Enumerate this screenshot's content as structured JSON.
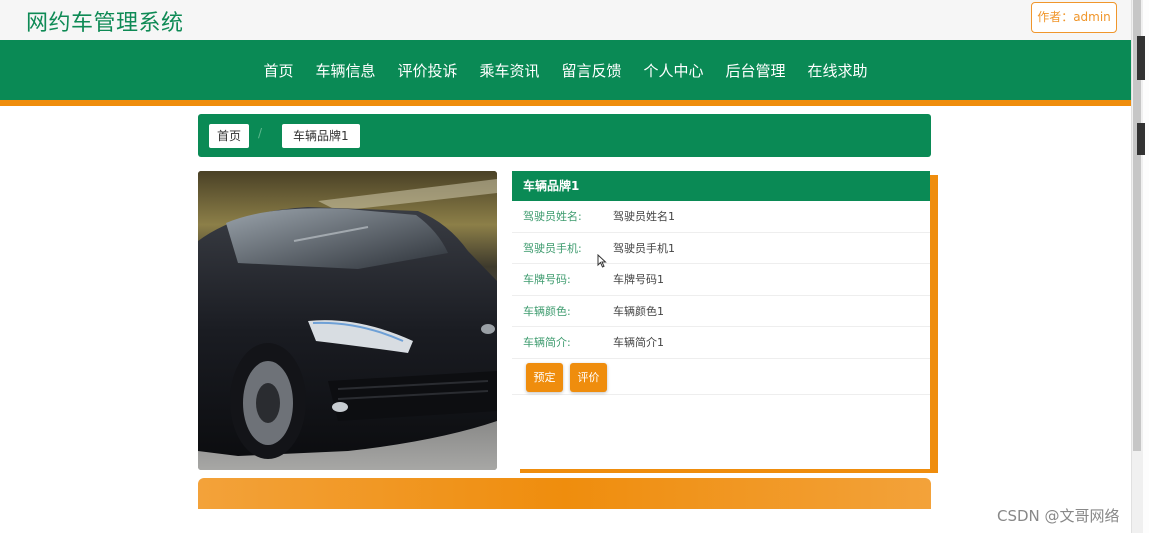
{
  "header": {
    "site_title": "网约车管理系统",
    "author_label": "作者：admin"
  },
  "nav": {
    "items": [
      "首页",
      "车辆信息",
      "评价投诉",
      "乘车资讯",
      "留言反馈",
      "个人中心",
      "后台管理",
      "在线求助"
    ]
  },
  "breadcrumb": {
    "home": "首页",
    "separator": "/",
    "current": "车辆品牌1"
  },
  "detail": {
    "title": "车辆品牌1",
    "fields": [
      {
        "label": "驾驶员姓名:",
        "value": "驾驶员姓名1"
      },
      {
        "label": "驾驶员手机:",
        "value": "驾驶员手机1"
      },
      {
        "label": "车牌号码:",
        "value": "车牌号码1"
      },
      {
        "label": "车辆颜色:",
        "value": "车辆颜色1"
      },
      {
        "label": "车辆简介:",
        "value": "车辆简介1"
      }
    ],
    "book_button": "预定",
    "review_button": "评价"
  },
  "watermark": "CSDN @文哥网络",
  "colors": {
    "primary_green": "#0a8a55",
    "accent_orange": "#ef8d0d"
  }
}
